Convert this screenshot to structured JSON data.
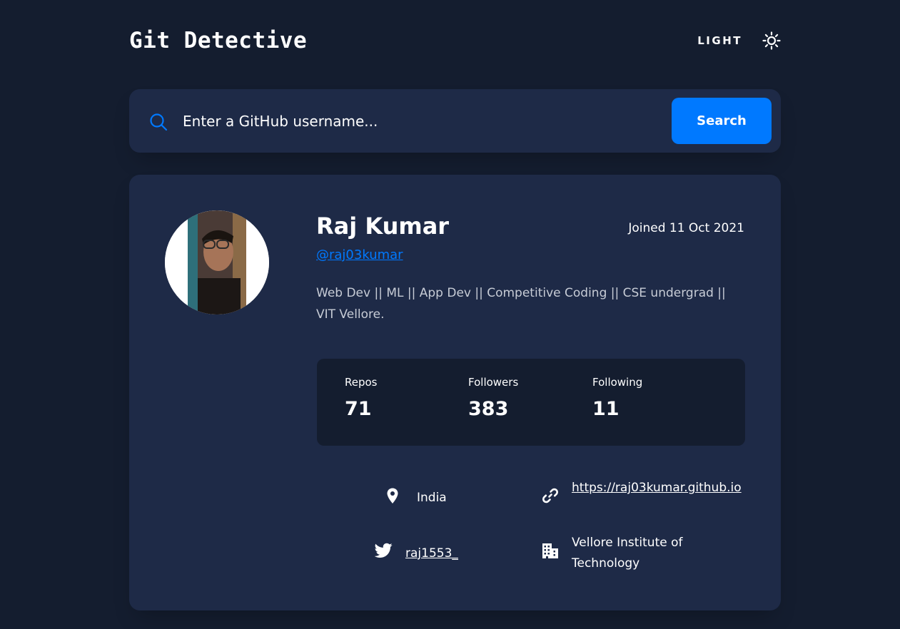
{
  "header": {
    "app_title": "Git Detective",
    "theme_label": "LIGHT",
    "theme_icon": "sun-icon"
  },
  "search": {
    "placeholder": "Enter a GitHub username...",
    "value": "",
    "button_label": "Search",
    "icon": "search-icon"
  },
  "profile": {
    "name": "Raj Kumar",
    "joined": "Joined 11 Oct 2021",
    "login": "@raj03kumar",
    "bio": "Web Dev || ML || App Dev || Competitive Coding || CSE undergrad || VIT Vellore."
  },
  "stats": {
    "repos_label": "Repos",
    "repos_value": "71",
    "followers_label": "Followers",
    "followers_value": "383",
    "following_label": "Following",
    "following_value": "11"
  },
  "info": {
    "location": "India",
    "website": "https://raj03kumar.github.io",
    "twitter": "raj1553_",
    "company": "Vellore Institute of Technology"
  },
  "colors": {
    "background": "#141d2f",
    "card": "#1e2a47",
    "accent": "#0079ff",
    "bio_text": "#c7ccd6"
  }
}
